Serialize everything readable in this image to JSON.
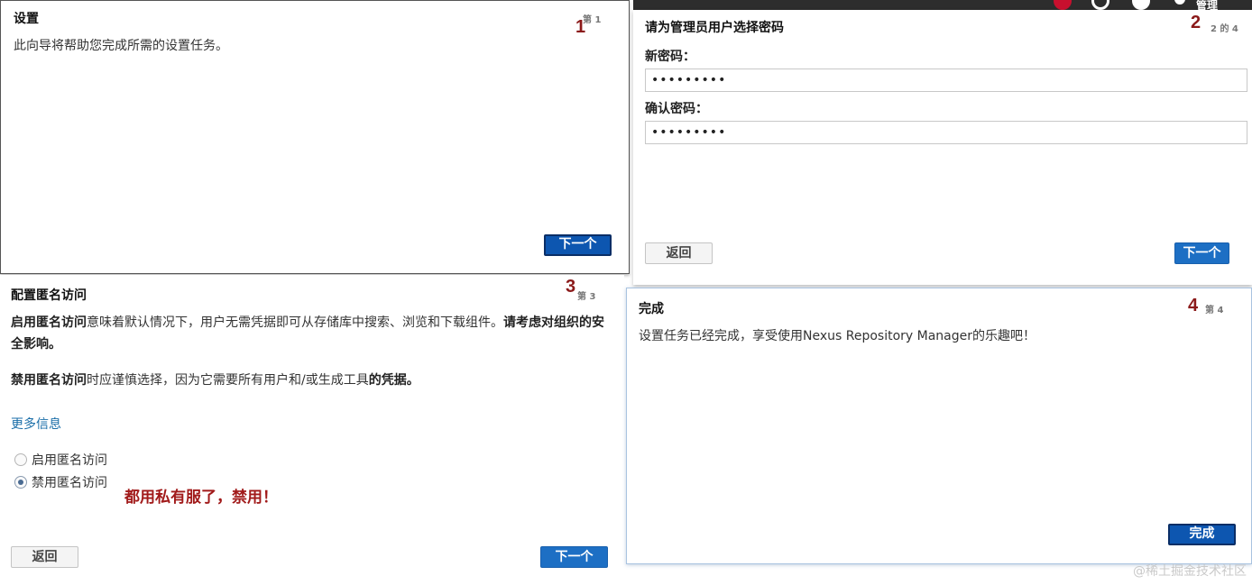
{
  "step1": {
    "title": "设置",
    "step_label": "第 1",
    "step_number": "1",
    "description": "此向导将帮助您完成所需的设置任务。",
    "next_button": "下一个"
  },
  "step2": {
    "title": "请为管理员用户选择密码",
    "step_label": "2 的 4",
    "step_number": "2",
    "new_password_label": "新密码：",
    "new_password_value": "•••••••••",
    "confirm_password_label": "确认密码：",
    "confirm_password_value": "•••••••••",
    "back_button": "返回",
    "next_button": "下一个",
    "toolbar_user": "管理"
  },
  "step3": {
    "title": "配置匿名访问",
    "step_label": "第 3",
    "step_number": "3",
    "para1_bold1": "启用匿名访问",
    "para1_text": "意味着默认情况下，用户无需凭据即可从存储库中搜索、浏览和下载组件。",
    "para1_bold2": "请考虑对组织的安全影响。",
    "para2_bold1": "禁用匿名访问",
    "para2_text": "时应谨慎选择，因为它需要所有用户和/或生成工具",
    "para2_bold2": "的凭据。",
    "more_info_link": "更多信息",
    "option_enable": "启用匿名访问",
    "option_disable": "禁用匿名访问",
    "selected_option": "禁用匿名访问",
    "annotation": "都用私有服了，禁用！",
    "back_button": "返回",
    "next_button": "下一个"
  },
  "step4": {
    "title": "完成",
    "step_label": "第 4",
    "step_number": "4",
    "description": "设置任务已经完成，享受使用Nexus Repository Manager的乐趣吧！",
    "finish_button": "完成"
  },
  "watermark": "@稀土掘金技术社区",
  "colors": {
    "primary_button": "#1d6fc4",
    "annotation_red": "#a11a1a",
    "link_blue": "#1a6ea8",
    "toolbar_dark": "#2d2d2d"
  }
}
